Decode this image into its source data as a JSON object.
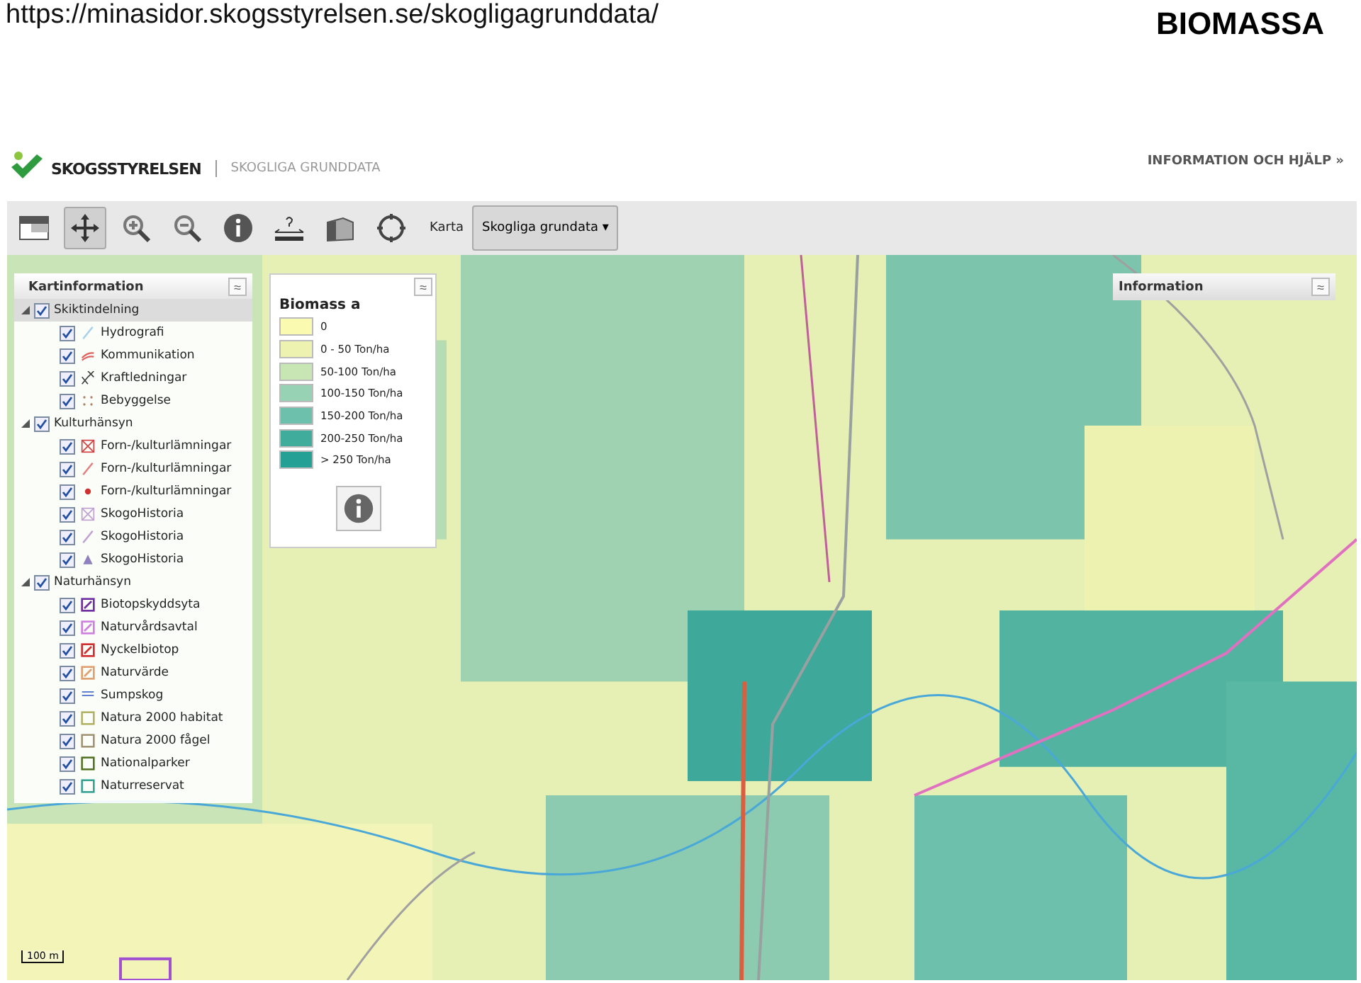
{
  "caption": {
    "url": "https://minasidor.skogsstyrelsen.se/skogligagrunddata/",
    "title": "BIOMASSA"
  },
  "header": {
    "brand": "SKOGSSTYRELSEN",
    "subtitle": "SKOGLIGA GRUNDDATA",
    "help_link": "INFORMATION OCH HJÄLP »"
  },
  "toolbar": {
    "tools": [
      {
        "kind": "overview",
        "selected": false
      },
      {
        "kind": "pan",
        "selected": true
      },
      {
        "kind": "zoom-in",
        "selected": false
      },
      {
        "kind": "zoom-out",
        "selected": false
      },
      {
        "kind": "info",
        "selected": false
      },
      {
        "kind": "measure",
        "selected": false
      },
      {
        "kind": "area",
        "selected": false
      },
      {
        "kind": "locate",
        "selected": false
      }
    ],
    "map_label": "Karta",
    "map_select": "Skogliga grundata ▾"
  },
  "layers_panel": {
    "title": "Kartinformation",
    "collapse": "≈",
    "groups": [
      {
        "label": "Skiktindelning",
        "checked": true,
        "expanded": true,
        "children": [
          {
            "label": "Hydrografi",
            "checked": true,
            "kind": "stroke",
            "color": "#a8d0ec"
          },
          {
            "label": "Kommunikation",
            "checked": true,
            "kind": "road",
            "color": "#e06060"
          },
          {
            "label": "Kraftledningar",
            "checked": true,
            "kind": "power",
            "color": "#404040"
          },
          {
            "label": "Bebyggelse",
            "checked": true,
            "kind": "dots",
            "color": "#b08060"
          }
        ]
      },
      {
        "label": "Kulturhänsyn",
        "checked": true,
        "expanded": true,
        "children": [
          {
            "label": "Forn-/kulturlämningar",
            "checked": true,
            "kind": "crossbox",
            "color": "#d04040"
          },
          {
            "label": "Forn-/kulturlämningar",
            "checked": true,
            "kind": "stroke",
            "color": "#e08080"
          },
          {
            "label": "Forn-/kulturlämningar",
            "checked": true,
            "kind": "dot",
            "color": "#d03030"
          },
          {
            "label": "SkogoHistoria",
            "checked": true,
            "kind": "crossbox",
            "color": "#c0a0d0"
          },
          {
            "label": "SkogoHistoria",
            "checked": true,
            "kind": "stroke",
            "color": "#c0a0d0"
          },
          {
            "label": "SkogoHistoria",
            "checked": true,
            "kind": "triangle",
            "color": "#9080c0"
          }
        ]
      },
      {
        "label": "Naturhänsyn",
        "checked": true,
        "expanded": true,
        "children": [
          {
            "label": "Biotopskyddsyta",
            "checked": true,
            "kind": "slashbox",
            "color": "#7030a0"
          },
          {
            "label": "Naturvårdsavtal",
            "checked": true,
            "kind": "slashbox",
            "color": "#d080e0"
          },
          {
            "label": "Nyckelbiotop",
            "checked": true,
            "kind": "slashbox",
            "color": "#d03030"
          },
          {
            "label": "Naturvärde",
            "checked": true,
            "kind": "slashbox",
            "color": "#e0a070"
          },
          {
            "label": "Sumpskog",
            "checked": true,
            "kind": "lines",
            "color": "#6080d0"
          },
          {
            "label": "Natura 2000 habitat",
            "checked": true,
            "kind": "box",
            "color": "#b0b060"
          },
          {
            "label": "Natura 2000 fågel",
            "checked": true,
            "kind": "box",
            "color": "#a09070"
          },
          {
            "label": "Nationalparker",
            "checked": true,
            "kind": "box",
            "color": "#507020"
          },
          {
            "label": "Naturreservat",
            "checked": true,
            "kind": "box",
            "color": "#30a090"
          }
        ]
      }
    ]
  },
  "legend_panel": {
    "title": "Biomass a",
    "collapse": "≈",
    "items": [
      {
        "label": "0",
        "color": "#fafab0"
      },
      {
        "label": "0 - 50 Ton/ha",
        "color": "#eef2b0"
      },
      {
        "label": "50-100 Ton/ha",
        "color": "#c8e6b4"
      },
      {
        "label": "100-150 Ton/ha",
        "color": "#98d2b4"
      },
      {
        "label": "150-200 Ton/ha",
        "color": "#6cc0ac"
      },
      {
        "label": "200-250 Ton/ha",
        "color": "#40ac9c"
      },
      {
        "label": "> 250 Ton/ha",
        "color": "#24a094"
      }
    ]
  },
  "info_panel": {
    "title": "Information",
    "expand": "≈"
  },
  "scale_bar": "100 m"
}
